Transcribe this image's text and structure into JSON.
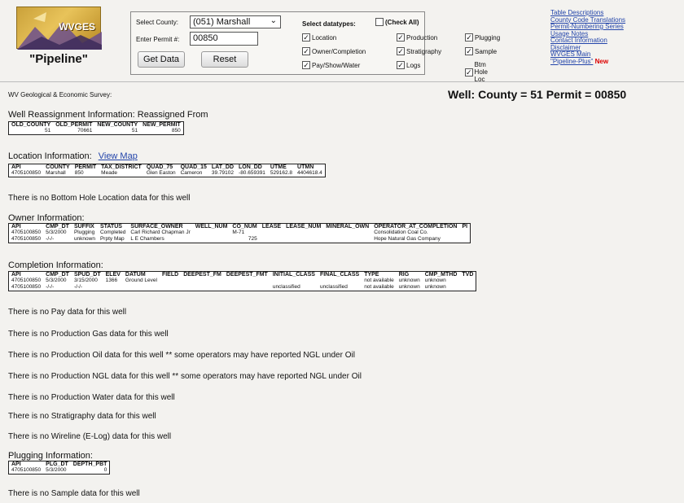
{
  "header": {
    "logo_text": "WVGES",
    "logo_caption": "\"Pipeline\"",
    "select_county_label": "Select County:",
    "county_value": "(051) Marshall",
    "permit_label": "Enter Permit #:",
    "permit_value": "00850",
    "get_data_label": "Get Data",
    "reset_label": "Reset",
    "datatypes_label": "Select datatypes:",
    "check_all_label": "(Check All)",
    "checkboxes": [
      {
        "label": "Location",
        "checked": true
      },
      {
        "label": "Production",
        "checked": true
      },
      {
        "label": "Plugging",
        "checked": true
      },
      {
        "label": "Owner/Completion",
        "checked": true
      },
      {
        "label": "Stratigraphy",
        "checked": true
      },
      {
        "label": "Sample",
        "checked": true
      },
      {
        "label": "Pay/Show/Water",
        "checked": true
      },
      {
        "label": "Logs",
        "checked": true
      },
      {
        "label": "Btm Hole Loc",
        "checked": true
      }
    ],
    "links": [
      "Table Descriptions",
      "County Code Translations",
      "Permit-Numbering Series",
      "Usage Notes",
      "Contact Information",
      "Disclaimer",
      "WVGES Main",
      "\"Pipeline-Plus\""
    ],
    "new_badge": "New"
  },
  "survey_label": "WV Geological & Economic Survey:",
  "well_heading": "Well:   County = 51 Permit = 00850",
  "reassign": {
    "title": "Well Reassignment Information: Reassigned From",
    "headers": [
      "OLD_COUNTY",
      "OLD_PERMIT",
      "NEW_COUNTY",
      "NEW_PERMIT"
    ],
    "rows": [
      [
        "51",
        "70661",
        "51",
        "850"
      ]
    ]
  },
  "location": {
    "title": "Location Information:",
    "view_map": "View Map",
    "headers": [
      "API",
      "COUNTY",
      "PERMIT",
      "TAX_DISTRICT",
      "QUAD_75",
      "QUAD_15",
      "LAT_DD",
      "LON_DD",
      "UTME",
      "UTMN"
    ],
    "rows": [
      [
        "4705100850",
        "Marshall",
        "850",
        "Meade",
        "Glen Easton",
        "Cameron",
        "39.79102",
        "-80.659391",
        "529162.8",
        "4404618.4"
      ]
    ]
  },
  "msg_bottom_hole": "There is no Bottom Hole Location data for this well",
  "owner": {
    "title": "Owner Information:",
    "headers": [
      "API",
      "CMP_DT",
      "SUFFIX",
      "STATUS",
      "SURFACE_OWNER",
      "WELL_NUM",
      "CO_NUM",
      "LEASE",
      "LEASE_NUM",
      "MINERAL_OWN",
      "OPERATOR_AT_COMPLETION",
      "PI"
    ],
    "rows": [
      [
        "4705100850",
        "5/3/2000",
        "Plugging",
        "Completed",
        "Carl Richard Chapman Jr",
        "",
        "M-71",
        "",
        "",
        "",
        "Consolidation Coal Co.",
        ""
      ],
      [
        "4705100850",
        "-/-/-",
        "unknown",
        "Prpty Map",
        "L E Chambers",
        "",
        "725",
        "",
        "",
        "",
        "Hope Natural Gas Company",
        ""
      ]
    ]
  },
  "completion": {
    "title": "Completion Information:",
    "headers": [
      "API",
      "CMP_DT",
      "SPUD_DT",
      "ELEV",
      "DATUM",
      "FIELD",
      "DEEPEST_FM",
      "DEEPEST_FMT",
      "INITIAL_CLASS",
      "FINAL_CLASS",
      "TYPE",
      "RIG",
      "CMP_MTHD",
      "TVD"
    ],
    "rows": [
      [
        "4705100850",
        "5/3/2000",
        "3/15/2000",
        "1366",
        "Ground Level",
        "",
        "",
        "",
        "",
        "",
        "not available",
        "unknown",
        "unknown",
        ""
      ],
      [
        "4705100850",
        "-/-/-",
        "-/-/-",
        "",
        "",
        "",
        "",
        "",
        "unclassified",
        "unclassified",
        "not available",
        "unknown",
        "unknown",
        ""
      ]
    ]
  },
  "messages": [
    {
      "text": "There is no Pay data for this well"
    },
    {
      "text": "There is no Production Gas data for this well"
    },
    {
      "text": "There is no Production Oil data for this well   ** some operators may have reported NGL under Oil"
    },
    {
      "text": "There is no Production NGL data for this well   ** some operators may have reported NGL under Oil"
    },
    {
      "text": "There is no Production Water data for this well"
    },
    {
      "text": "There is no Stratigraphy data for this well"
    },
    {
      "text": "There is no Wireline (E-Log) data for this well"
    }
  ],
  "plugging": {
    "title": "Plugging Information:",
    "headers": [
      "API",
      "PLG_DT",
      "DEPTH_PBT"
    ],
    "rows": [
      [
        "4705100850",
        "5/3/2000",
        "0"
      ]
    ]
  },
  "msg_sample": "There is no Sample data for this well"
}
